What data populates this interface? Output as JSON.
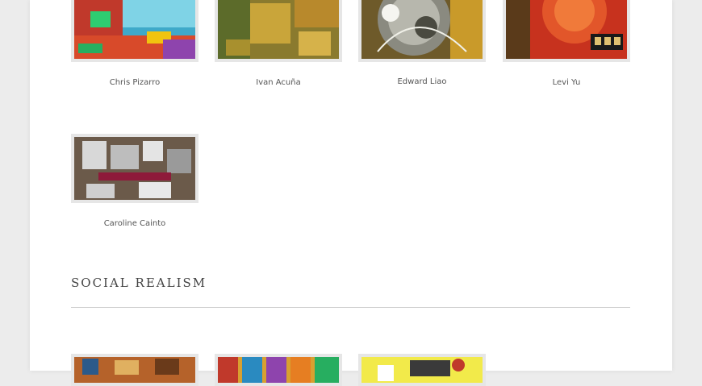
{
  "artists_row1": [
    {
      "name": "Chris Pizarro",
      "icon": "painting-thumbnail-colorful-abstract"
    },
    {
      "name": "Ivan Acuña",
      "icon": "painting-thumbnail-golden-abstract"
    },
    {
      "name": "Edward Liao",
      "icon": "painting-thumbnail-circular-abstract"
    },
    {
      "name": "Levi Yu",
      "icon": "painting-thumbnail-red-abstract"
    }
  ],
  "artists_row2": [
    {
      "name": "Caroline Cainto",
      "icon": "painting-thumbnail-grey-collage"
    }
  ],
  "social_realism": {
    "title": "SOCIAL REALISM"
  },
  "colors": {
    "background": "#ececec",
    "page": "#ffffff",
    "thumb_frame": "#e6e6e6",
    "caption_text": "#555555"
  }
}
